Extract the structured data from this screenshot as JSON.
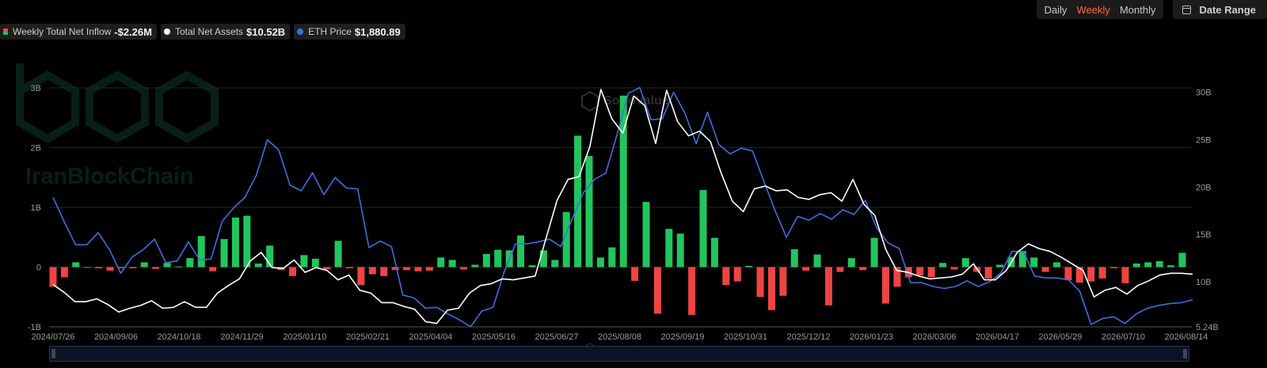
{
  "controls": {
    "ranges": [
      "Daily",
      "Weekly",
      "Monthly"
    ],
    "active_range": "Weekly",
    "date_range_label": "Date Range"
  },
  "legend": [
    {
      "label": "Weekly Total Net Inflow",
      "value": "-$2.26M"
    },
    {
      "label": "Total Net Assets",
      "value": "$10.52B"
    },
    {
      "label": "ETH Price",
      "value": "$1,880.89"
    }
  ],
  "watermarks": {
    "brand": "IranBlockChain",
    "sosovalue": "SoSoValue"
  },
  "colors": {
    "positive": "#22c55e",
    "negative": "#ef4444",
    "net_assets": "#ffffff",
    "eth_price": "#3b6fe0",
    "grid": "#262626",
    "background": "#000000"
  },
  "chart_data": {
    "type": "bar",
    "grid": true,
    "legend_position": "top-left",
    "x_tick_labels": [
      "2024/07/26",
      "2024/09/06",
      "2024/10/18",
      "2024/11/29",
      "2025/01/10",
      "2025/02/21",
      "2025/04/04",
      "2025/05/16",
      "2025/06/27",
      "2025/08/08",
      "2025/09/19",
      "2025/10/31",
      "2025/12/12",
      "2026/01/23",
      "2026/03/06",
      "2026/04/17",
      "2026/05/29",
      "2026/07/10",
      "2026/08/14"
    ],
    "y_left": {
      "ticks": [
        "3B",
        "2B",
        "1B",
        "0",
        "-1B"
      ],
      "range": [
        -1.0,
        3.0
      ],
      "unit": "USD"
    },
    "y_right": {
      "ticks": [
        "30B",
        "25B",
        "20B",
        "15B",
        "10B",
        "5.24B"
      ],
      "range": [
        5.24,
        30.47
      ],
      "unit": "USD"
    },
    "series": [
      {
        "name": "Weekly Total Net Inflow",
        "type": "bar",
        "axis": "left",
        "values": [
          -0.33,
          -0.17,
          0.08,
          -0.01,
          -0.02,
          -0.06,
          -0.02,
          -0.02,
          0.08,
          -0.03,
          0.07,
          0.01,
          0.15,
          0.52,
          -0.07,
          0.47,
          0.83,
          0.86,
          0.06,
          0.36,
          -0.05,
          -0.15,
          0.2,
          0.14,
          -0.04,
          0.44,
          -0.02,
          -0.3,
          -0.12,
          -0.15,
          -0.05,
          -0.05,
          -0.07,
          -0.06,
          0.16,
          0.12,
          -0.04,
          0.04,
          0.22,
          0.29,
          0.28,
          0.53,
          0.03,
          0.28,
          0.12,
          0.92,
          2.2,
          1.86,
          0.16,
          0.33,
          2.87,
          -0.23,
          1.09,
          -0.78,
          0.64,
          0.56,
          -0.8,
          1.29,
          0.49,
          -0.3,
          -0.24,
          0.02,
          -0.5,
          -0.72,
          -0.48,
          0.3,
          -0.06,
          0.21,
          -0.64,
          -0.08,
          0.15,
          -0.05,
          0.49,
          -0.61,
          -0.33,
          -0.17,
          -0.14,
          -0.17,
          0.07,
          -0.04,
          0.15,
          -0.08,
          -0.19,
          0.04,
          0.17,
          0.27,
          0.16,
          -0.08,
          0.08,
          -0.22,
          -0.26,
          -0.24,
          -0.19,
          -0.02,
          -0.27,
          0.06,
          0.08,
          0.1,
          0.03,
          0.24
        ]
      },
      {
        "name": "Total Net Assets",
        "type": "line",
        "axis": "right",
        "values": [
          9.7,
          8.9,
          7.9,
          7.9,
          8.2,
          7.6,
          6.8,
          7.2,
          7.5,
          8.0,
          7.2,
          7.3,
          7.9,
          7.3,
          7.3,
          8.8,
          9.6,
          10.3,
          12.2,
          13.1,
          11.5,
          11.4,
          12.3,
          11.0,
          11.5,
          11.2,
          10.2,
          10.7,
          9.1,
          8.8,
          7.8,
          7.8,
          7.4,
          7.1,
          5.8,
          5.6,
          7.0,
          7.2,
          8.8,
          9.6,
          9.8,
          10.3,
          10.2,
          10.4,
          10.6,
          14.6,
          18.6,
          20.8,
          21.1,
          24.3,
          30.3,
          27.2,
          25.7,
          29.6,
          28.6,
          24.6,
          30.2,
          26.9,
          25.4,
          25.9,
          24.8,
          21.4,
          18.5,
          17.4,
          19.8,
          20.1,
          19.6,
          19.7,
          18.9,
          18.7,
          19.2,
          19.4,
          18.5,
          20.8,
          18.2,
          17.0,
          13.4,
          11.2,
          11.0,
          10.6,
          10.3,
          10.4,
          10.5,
          10.8,
          11.9,
          10.2,
          10.2,
          11.2,
          13.1,
          14.0,
          13.5,
          13.2,
          12.6,
          11.9,
          11.2,
          8.4,
          9.1,
          9.4,
          8.7,
          9.6,
          10.1,
          10.7,
          10.9,
          10.9,
          10.8
        ]
      },
      {
        "name": "ETH Price",
        "type": "line",
        "axis": "right",
        "values": [
          18.9,
          16.3,
          13.9,
          13.9,
          15.2,
          13.4,
          10.9,
          12.6,
          13.4,
          14.5,
          12.0,
          12.2,
          14.2,
          12.3,
          12.4,
          16.4,
          17.8,
          18.9,
          21.2,
          25.0,
          23.9,
          20.2,
          19.6,
          21.5,
          19.2,
          21.0,
          19.9,
          19.8,
          13.6,
          14.3,
          13.7,
          8.6,
          8.3,
          7.2,
          7.3,
          6.6,
          6.0,
          5.24,
          6.9,
          7.3,
          11.1,
          14.0,
          14.0,
          14.2,
          14.5,
          13.7,
          16.6,
          19.4,
          20.8,
          21.5,
          25.6,
          29.9,
          30.5,
          27.1,
          27.2,
          30.0,
          27.8,
          24.6,
          27.9,
          24.5,
          23.5,
          24.1,
          23.8,
          20.6,
          17.5,
          14.7,
          16.9,
          16.5,
          17.2,
          16.6,
          17.6,
          17.1,
          18.6,
          15.7,
          14.1,
          13.5,
          9.9,
          9.9,
          9.5,
          9.3,
          9.5,
          10.1,
          9.5,
          10.0,
          10.9,
          13.2,
          13.2,
          10.6,
          10.4,
          10.4,
          10.2,
          9.0,
          5.5,
          6.1,
          6.3,
          5.6,
          6.6,
          7.2,
          7.5,
          7.7,
          7.8,
          8.1
        ]
      }
    ]
  }
}
